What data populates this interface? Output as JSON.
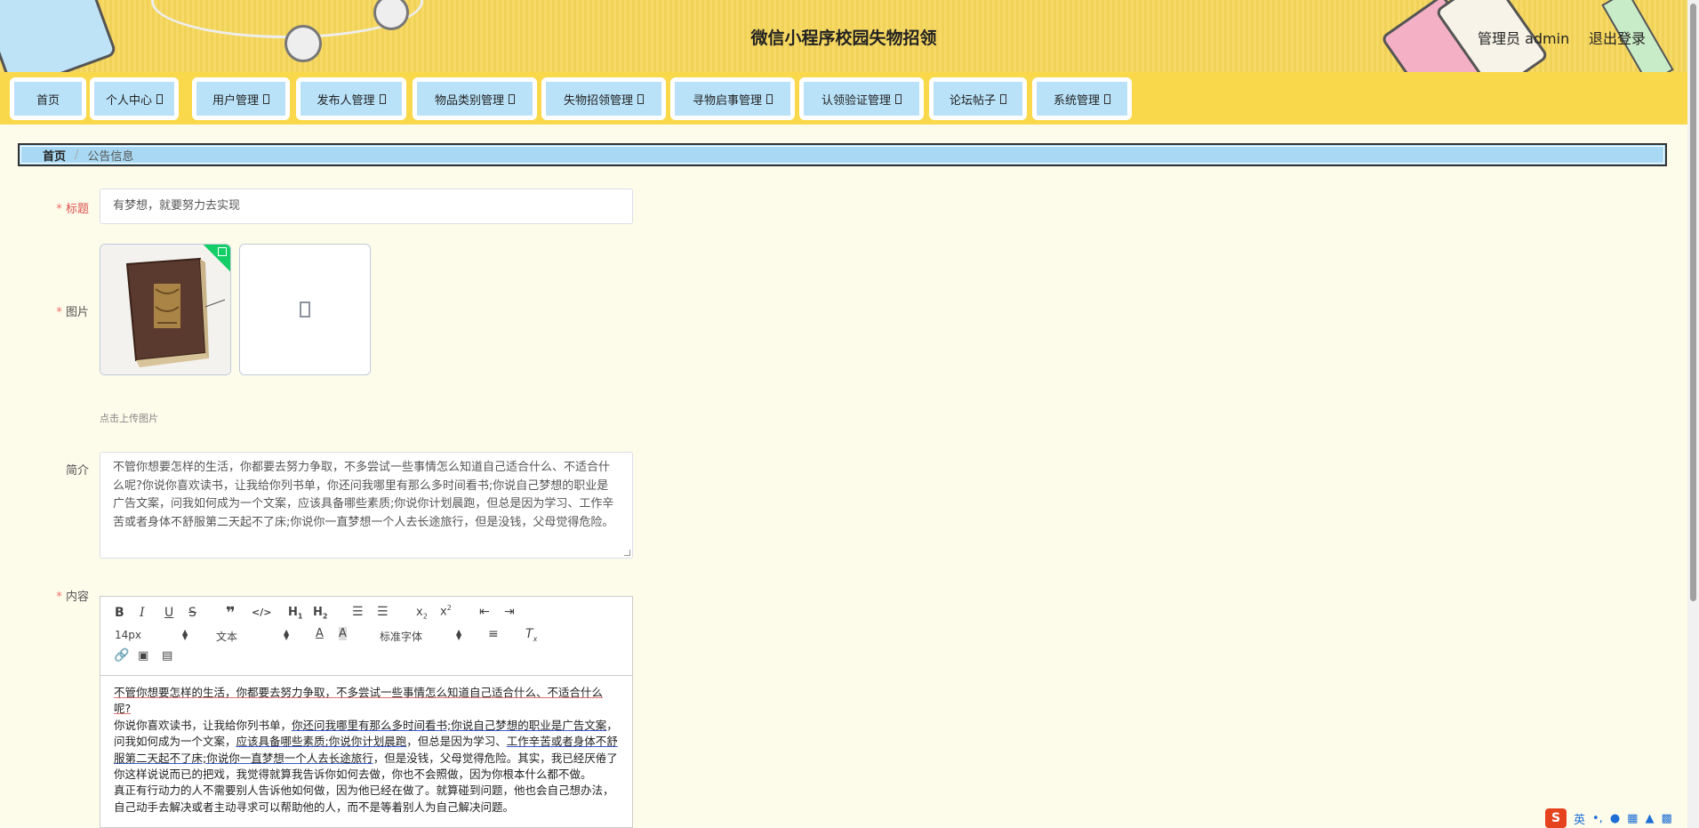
{
  "header": {
    "title": "微信小程序校园失物招领",
    "admin_label": "管理员 admin",
    "logout_label": "退出登录"
  },
  "nav": {
    "items": [
      {
        "label": "首页",
        "has_arrow": false
      },
      {
        "label": "个人中心",
        "has_arrow": true
      },
      {
        "label": "用户管理",
        "has_arrow": true
      },
      {
        "label": "发布人管理",
        "has_arrow": true
      },
      {
        "label": "物品类别管理",
        "has_arrow": true
      },
      {
        "label": "失物招领管理",
        "has_arrow": true
      },
      {
        "label": "寻物启事管理",
        "has_arrow": true
      },
      {
        "label": "认领验证管理",
        "has_arrow": true
      },
      {
        "label": "论坛帖子",
        "has_arrow": true
      },
      {
        "label": "系统管理",
        "has_arrow": true
      }
    ]
  },
  "breadcrumb": {
    "home": "首页",
    "separator": "/",
    "current": "公告信息"
  },
  "form": {
    "title_label": "标题",
    "title_value": "有梦想，就要努力去实现",
    "image_label": "图片",
    "upload_hint": "点击上传图片",
    "intro_label": "简介",
    "intro_value": "不管你想要怎样的生活，你都要去努力争取，不多尝试一些事情怎么知道自己适合什么、不适合什么呢?你说你喜欢读书，让我给你列书单，你还问我哪里有那么多时间看书;你说自己梦想的职业是广告文案，问我如何成为一个文案，应该具备哪些素质;你说你计划晨跑，但总是因为学习、工作辛苦或者身体不舒服第二天起不了床;你说你一直梦想一个人去长途旅行，但是没钱，父母觉得危险。",
    "content_label": "内容",
    "required_mark": "*"
  },
  "editor": {
    "font_size": "14px",
    "block_format": "文本",
    "font_family": "标准字体",
    "tools": [
      "bold-icon",
      "italic-icon",
      "underline-icon",
      "strike-icon",
      "blockquote-icon",
      "code-icon",
      "h1-icon",
      "h2-icon",
      "ordered-list-icon",
      "bullet-list-icon",
      "subscript-icon",
      "superscript-icon",
      "outdent-icon",
      "indent-icon",
      "font-color-icon",
      "background-color-icon",
      "align-icon",
      "clear-format-icon",
      "link-icon",
      "image-icon",
      "video-icon"
    ],
    "content": {
      "p1": "不管你想要怎样的生活，你都要去努力争取，不多尝试一些事情怎么知道自己适合什么、不适合什么呢?",
      "p2_a": "你说你喜欢读书，让我给你列书单，",
      "p2_b": "你还问我哪里有那么多时间看书;你说自己梦想的职业是广告文案",
      "p2_c": "，问我如何成为一个文案，",
      "p2_d": "应该具备哪些素质;你说你计划晨跑",
      "p2_e": "，但总是因为学习、",
      "p2_f": "工作辛苦或者身体不舒服第二天起不了床;你说你一直梦想一个人去长途旅行",
      "p2_g": "，但是没钱，父母觉得危险。其实，我已经厌倦了你这样说说而已的把戏，我觉得就算我告诉你如何去做，你也不会照做，因为你根本什么都不做。",
      "p3": "真正有行动力的人不需要别人告诉他如何做，因为他已经在做了。就算碰到问题，他也会自己想办法，自己动手去解决或者主动寻求可以帮助他的人，而不是等着别人为自己解决问题。"
    }
  },
  "ime": {
    "logo": "S",
    "lang": "英"
  },
  "colors": {
    "header_bg": "#f6d65a",
    "nav_item_bg": "#b9e2f9",
    "breadcrumb_bg": "#a8d8f3",
    "page_bg": "#fdfbea",
    "required": "#f56c6c"
  }
}
